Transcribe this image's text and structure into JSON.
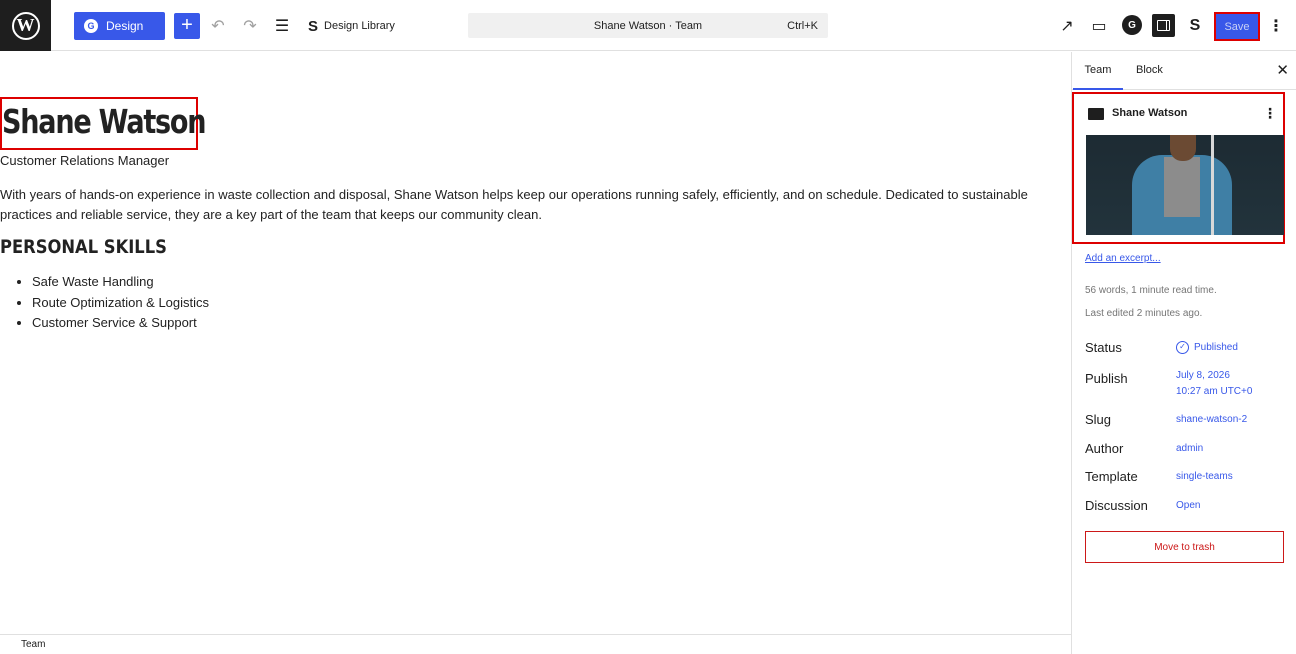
{
  "topbar": {
    "wp_logo": "W",
    "design_label": "Design",
    "plus_label": "+",
    "design_library_label": "Design Library",
    "command_title": "Shane Watson · Team",
    "command_shortcut": "Ctrl+K",
    "save_label": "Save",
    "icons": [
      "undo-icon",
      "redo-icon",
      "list-view-icon",
      "external-link-icon",
      "device-preview-icon",
      "sidebar-toggle-icon",
      "options-icon"
    ]
  },
  "content": {
    "title": "Shane Watson",
    "job_title": "Customer Relations Manager",
    "bio": "With years of hands-on experience in waste collection and disposal, Shane Watson helps keep our operations running safely, efficiently, and on schedule. Dedicated to sustainable practices and reliable service, they are a key part of the team that keeps our community clean.",
    "skills_heading": "PERSONAL SKILLS",
    "skills": [
      "Safe Waste Handling",
      "Route Optimization & Logistics",
      "Customer Service & Support"
    ]
  },
  "footer": {
    "breadcrumb": "Team"
  },
  "sidebar": {
    "tabs": [
      "Team",
      "Block"
    ],
    "card_title": "Shane Watson",
    "excerpt_link": "Add an excerpt...",
    "word_count": "56 words, 1 minute read time.",
    "last_edited": "Last edited 2 minutes ago.",
    "rows": [
      {
        "key": "Status",
        "value": "Published"
      },
      {
        "key": "Publish",
        "value": "July 8, 2026",
        "value2": "10:27 am UTC+0"
      },
      {
        "key": "Slug",
        "value": "shane-watson-2"
      },
      {
        "key": "Author",
        "value": "admin"
      },
      {
        "key": "Template",
        "value": "single-teams"
      },
      {
        "key": "Discussion",
        "value": "Open"
      }
    ],
    "trash_label": "Move to trash",
    "colors": {
      "accent": "#3858e9",
      "danger": "#cc1818",
      "highlight": "#dd0000"
    }
  }
}
